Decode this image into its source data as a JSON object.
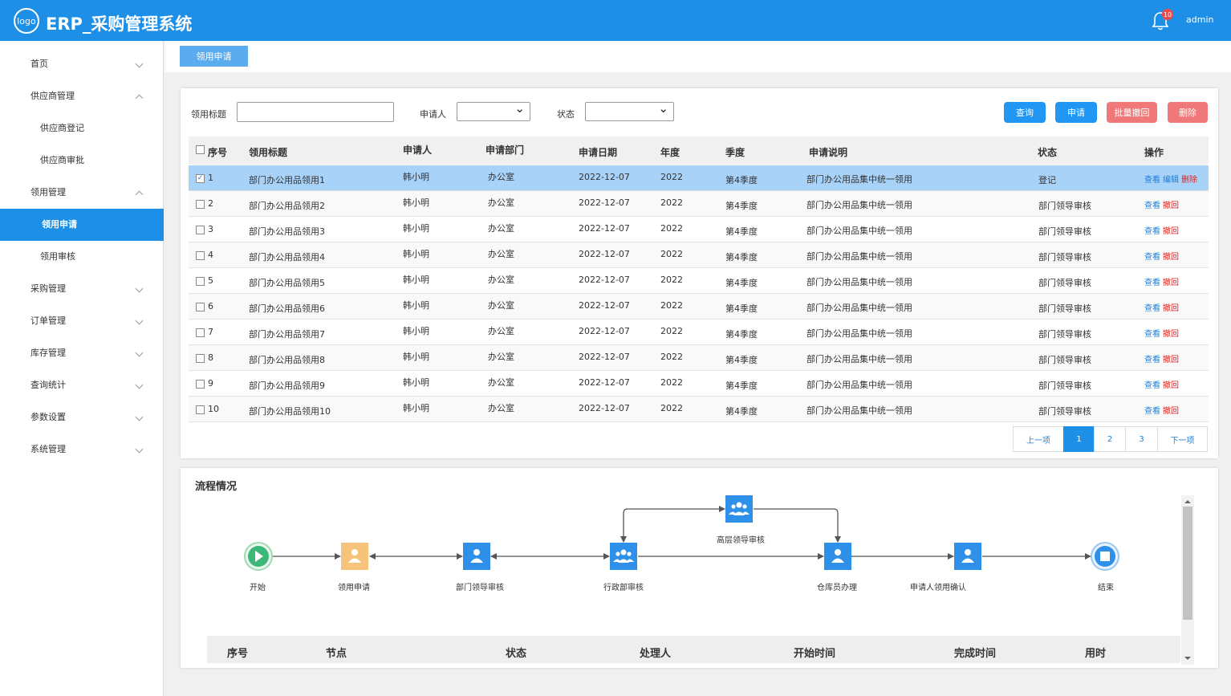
{
  "header": {
    "logo_text": "logo",
    "title": "ERP_采购管理系统",
    "bell_count": "10",
    "user": "admin"
  },
  "sidebar": {
    "items": [
      {
        "label": "首页"
      },
      {
        "label": "供应商管理"
      },
      {
        "label": "供应商登记"
      },
      {
        "label": "供应商审批"
      },
      {
        "label": "领用管理"
      },
      {
        "label": "领用申请"
      },
      {
        "label": "领用审核"
      },
      {
        "label": "采购管理"
      },
      {
        "label": "订单管理"
      },
      {
        "label": "库存管理"
      },
      {
        "label": "查询统计"
      },
      {
        "label": "参数设置"
      },
      {
        "label": "系统管理"
      }
    ]
  },
  "tabs": {
    "active": "领用申请"
  },
  "filter": {
    "title_label": "领用标题",
    "title_value": "",
    "applicant_label": "申请人",
    "applicant_value": "",
    "status_label": "状态",
    "status_value": "",
    "query": "查询",
    "apply": "申请",
    "batch_withdraw": "批量撤回",
    "delete": "删除"
  },
  "colors": {
    "primary": "#1e8fe6",
    "query_btn": "#2196f3",
    "batch_btn": "#f07878",
    "del_btn": "#f07878",
    "flow_node": "#2e90e8",
    "flow_apply": "#f5c37c",
    "start_green": "#3cb878"
  },
  "table": {
    "headers": [
      "序号",
      "领用标题",
      "申请人",
      "申请部门",
      "申请日期",
      "年度",
      "季度",
      "申请说明",
      "状态",
      "操作"
    ],
    "ops": {
      "view": "查看",
      "edit": "编辑",
      "delete": "删除",
      "withdraw": "撤回"
    },
    "rows": [
      {
        "no": "1",
        "title": "部门办公用品领用1",
        "applicant": "韩小明",
        "dept": "办公室",
        "date": "2022-12-07",
        "year": "2022",
        "quarter": "第4季度",
        "desc": "部门办公用品集中统一领用",
        "status": "登记"
      },
      {
        "no": "2",
        "title": "部门办公用品领用2",
        "applicant": "韩小明",
        "dept": "办公室",
        "date": "2022-12-07",
        "year": "2022",
        "quarter": "第4季度",
        "desc": "部门办公用品集中统一领用",
        "status": "部门领导审核"
      },
      {
        "no": "3",
        "title": "部门办公用品领用3",
        "applicant": "韩小明",
        "dept": "办公室",
        "date": "2022-12-07",
        "year": "2022",
        "quarter": "第4季度",
        "desc": "部门办公用品集中统一领用",
        "status": "部门领导审核"
      },
      {
        "no": "4",
        "title": "部门办公用品领用4",
        "applicant": "韩小明",
        "dept": "办公室",
        "date": "2022-12-07",
        "year": "2022",
        "quarter": "第4季度",
        "desc": "部门办公用品集中统一领用",
        "status": "部门领导审核"
      },
      {
        "no": "5",
        "title": "部门办公用品领用5",
        "applicant": "韩小明",
        "dept": "办公室",
        "date": "2022-12-07",
        "year": "2022",
        "quarter": "第4季度",
        "desc": "部门办公用品集中统一领用",
        "status": "部门领导审核"
      },
      {
        "no": "6",
        "title": "部门办公用品领用6",
        "applicant": "韩小明",
        "dept": "办公室",
        "date": "2022-12-07",
        "year": "2022",
        "quarter": "第4季度",
        "desc": "部门办公用品集中统一领用",
        "status": "部门领导审核"
      },
      {
        "no": "7",
        "title": "部门办公用品领用7",
        "applicant": "韩小明",
        "dept": "办公室",
        "date": "2022-12-07",
        "year": "2022",
        "quarter": "第4季度",
        "desc": "部门办公用品集中统一领用",
        "status": "部门领导审核"
      },
      {
        "no": "8",
        "title": "部门办公用品领用8",
        "applicant": "韩小明",
        "dept": "办公室",
        "date": "2022-12-07",
        "year": "2022",
        "quarter": "第4季度",
        "desc": "部门办公用品集中统一领用",
        "status": "部门领导审核"
      },
      {
        "no": "9",
        "title": "部门办公用品领用9",
        "applicant": "韩小明",
        "dept": "办公室",
        "date": "2022-12-07",
        "year": "2022",
        "quarter": "第4季度",
        "desc": "部门办公用品集中统一领用",
        "status": "部门领导审核"
      },
      {
        "no": "10",
        "title": "部门办公用品领用10",
        "applicant": "韩小明",
        "dept": "办公室",
        "date": "2022-12-07",
        "year": "2022",
        "quarter": "第4季度",
        "desc": "部门办公用品集中统一领用",
        "status": "部门领导审核"
      }
    ]
  },
  "pagination": {
    "prev": "上一项",
    "pages": [
      "1",
      "2",
      "3"
    ],
    "current": "1",
    "next": "下一项"
  },
  "flow": {
    "title": "流程情况",
    "nodes": [
      "开始",
      "领用申请",
      "部门领导审核",
      "行政部审核",
      "高层领导审核",
      "仓库员办理",
      "申请人领用确认",
      "结束"
    ],
    "log_headers": [
      "序号",
      "节点",
      "状态",
      "处理人",
      "开始时间",
      "完成时间",
      "用时"
    ]
  }
}
